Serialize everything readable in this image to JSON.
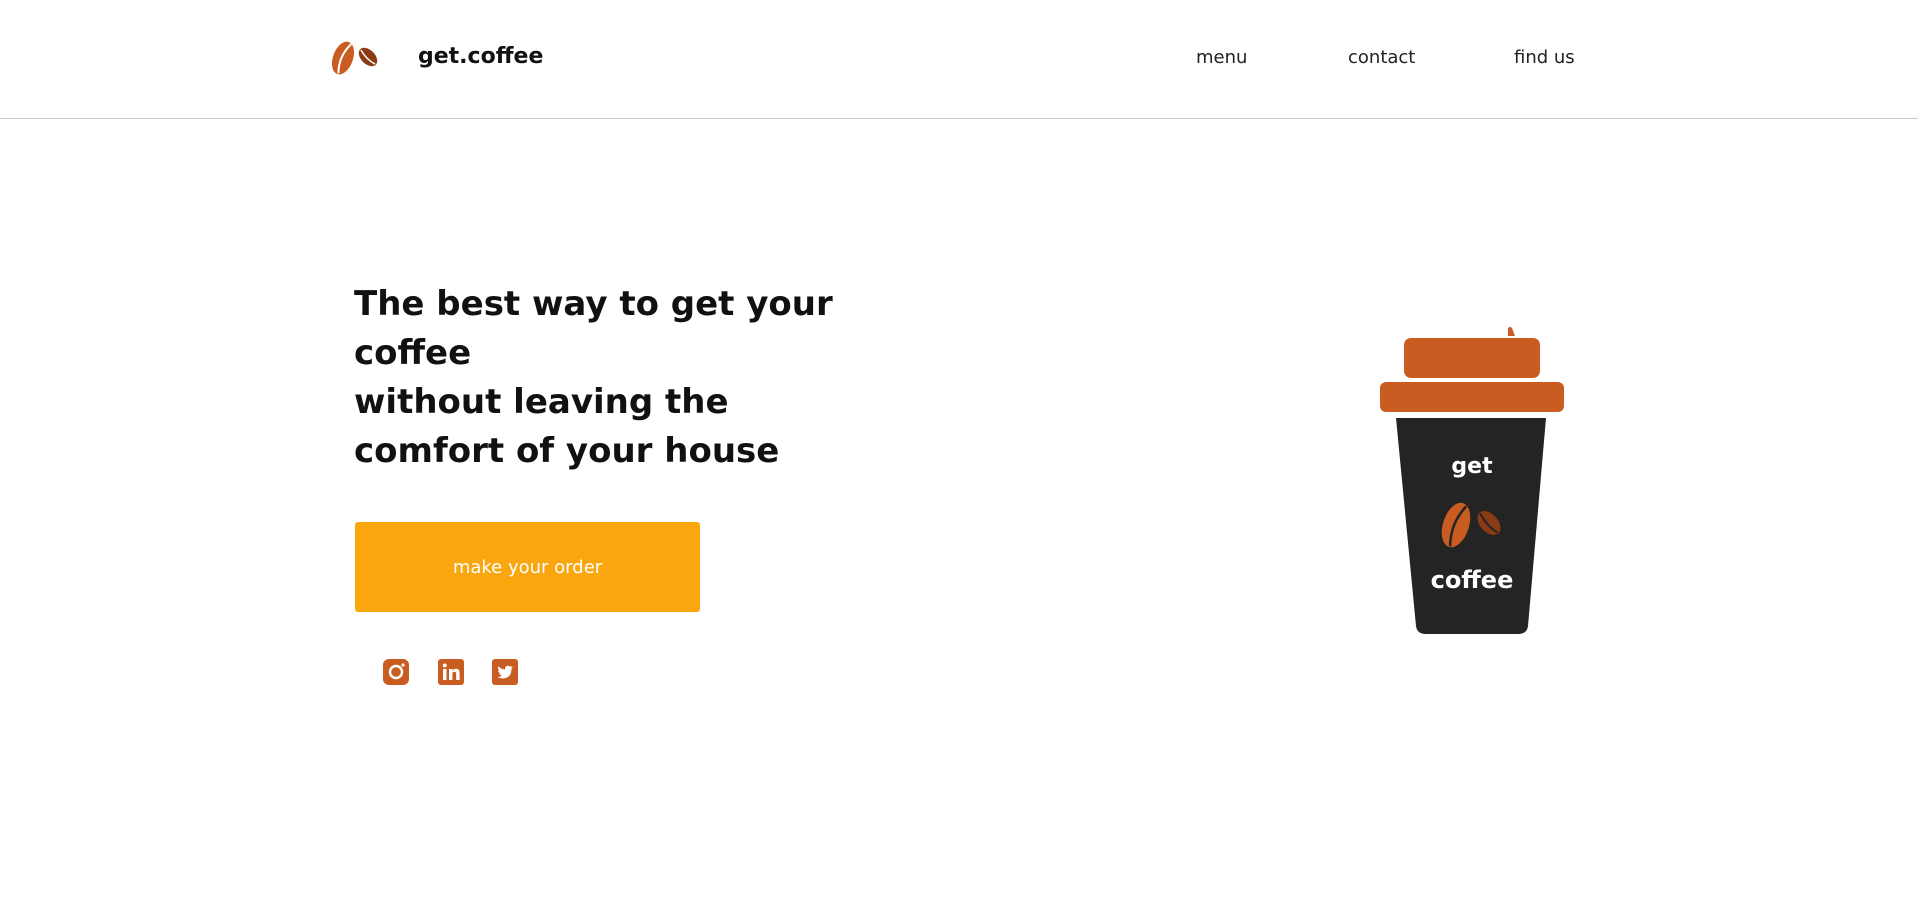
{
  "header": {
    "brand": "get.coffee",
    "nav": {
      "menu": "menu",
      "contact": "contact",
      "find_us": "find us"
    }
  },
  "hero": {
    "headline_lines": [
      "The best way to get your coffee",
      "without leaving the comfort of your house"
    ],
    "cta_label": "make your order"
  },
  "social": [
    "instagram-icon",
    "linkedin-icon",
    "twitter-icon"
  ],
  "cup": {
    "text_top": "get",
    "text_bottom": "coffee"
  },
  "colors": {
    "accent": "#f9a60f",
    "brown": "#c95c20",
    "dark_brown": "#8a3a14",
    "cup_body": "#242424"
  }
}
